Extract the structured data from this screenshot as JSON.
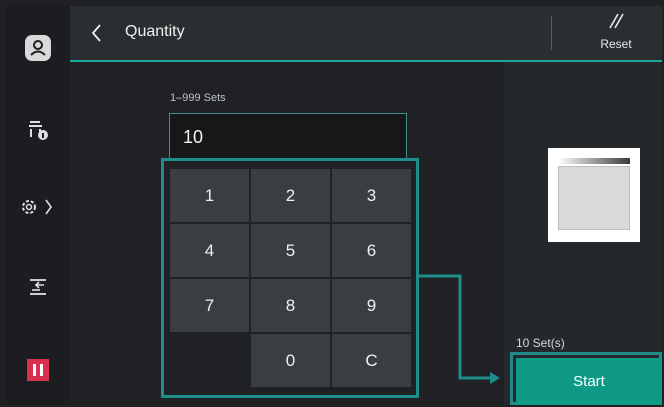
{
  "header": {
    "title": "Quantity",
    "reset_label": "Reset"
  },
  "quantity": {
    "range_label": "1–999 Sets",
    "value": "10"
  },
  "keypad": {
    "keys": [
      "1",
      "2",
      "3",
      "4",
      "5",
      "6",
      "7",
      "8",
      "9",
      "",
      "0",
      "C"
    ]
  },
  "status": {
    "sets_label": "10 Set(s)"
  },
  "actions": {
    "start_label": "Start"
  },
  "left_rail": {
    "icons": [
      "user-icon",
      "printer-info-icon",
      "settings-gear-icon",
      "swap-icon",
      "stop-icon"
    ]
  },
  "colors": {
    "accent": "#1e8c8a",
    "start_button": "#0f9a85",
    "stop_button": "#d9304f",
    "header_bg": "#2b2e31"
  }
}
